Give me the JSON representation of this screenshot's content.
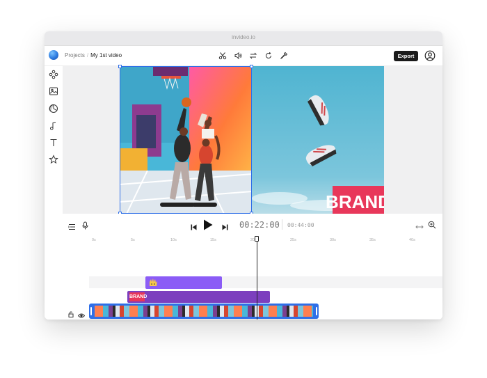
{
  "browser": {
    "url": "invideo.io"
  },
  "header": {
    "breadcrumb_root": "Projects",
    "breadcrumb_sep": "/",
    "project_name": "My 1st video",
    "export_label": "Export",
    "tools": [
      "scissors-icon",
      "volume-icon",
      "swap-icon",
      "rotate-icon",
      "eyedropper-icon"
    ]
  },
  "sidebar": {
    "items": [
      "elements-icon",
      "media-icon",
      "sticker-icon",
      "music-icon",
      "text-icon",
      "star-icon"
    ]
  },
  "preview": {
    "brand_text": "BRAND",
    "selection_color": "#2f6fe8"
  },
  "playback": {
    "current_time": "00:22:00",
    "total_time": "00:44:00"
  },
  "timeline": {
    "ruler": [
      "0s",
      "5s",
      "10s",
      "15s",
      "20s",
      "25s",
      "30s",
      "35s",
      "40s"
    ],
    "overlay_clip_label": "BRAND",
    "colors": {
      "sticker": "#8b5cf6",
      "overlay": "#7c3fbe",
      "video_track": "#2f6fe8",
      "broll": "#7fc6d8",
      "audio": "#57c468"
    }
  }
}
